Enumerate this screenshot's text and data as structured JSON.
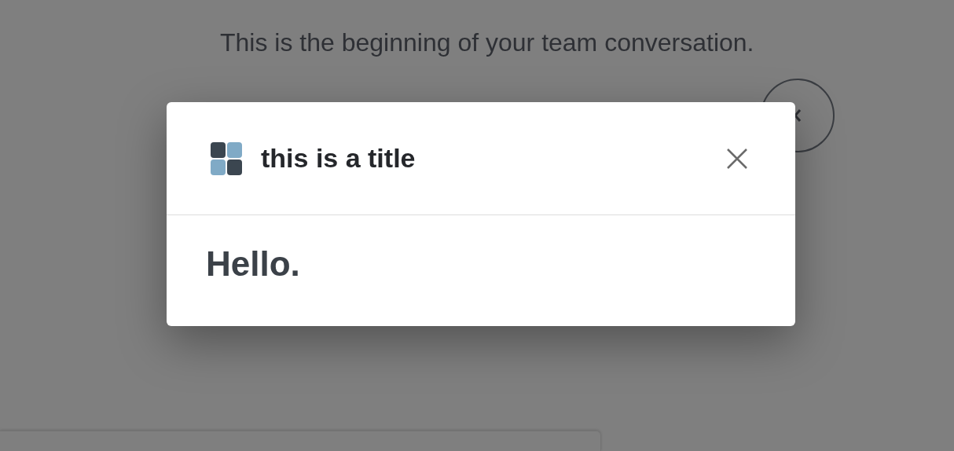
{
  "conversation_intro": "This is the beginning of your team conversation.",
  "dialog": {
    "title": "this is a title",
    "body": "Hello."
  }
}
